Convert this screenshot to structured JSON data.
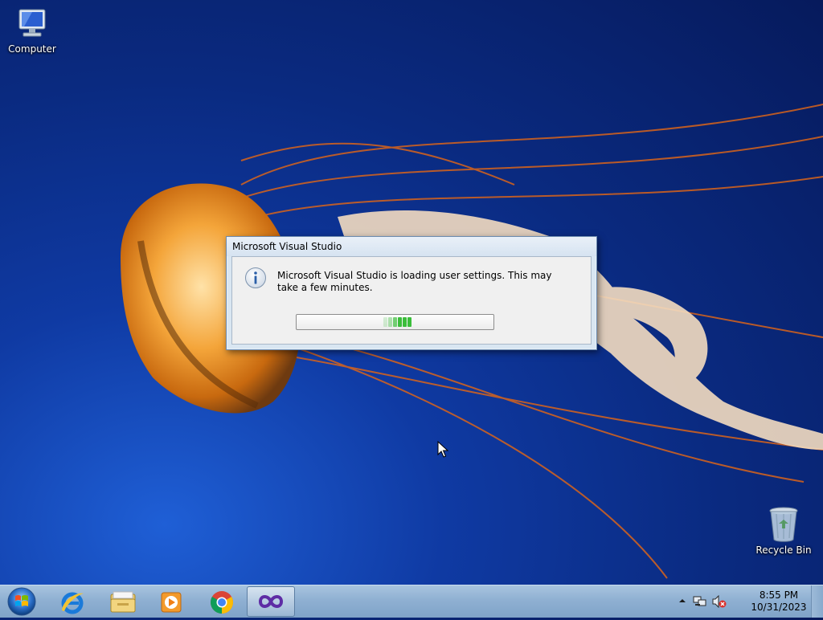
{
  "desktop": {
    "icons": [
      {
        "label": "Computer",
        "icon": "computer-icon"
      },
      {
        "label": "Recycle Bin",
        "icon": "recycle-bin-icon"
      }
    ]
  },
  "dialog": {
    "title": "Microsoft Visual Studio",
    "message": "Microsoft Visual Studio is loading user settings. This may take a few minutes.",
    "icon": "info-icon",
    "progress": {
      "mode": "indeterminate",
      "fill_color": "#3bbd3b"
    }
  },
  "taskbar": {
    "start_icon": "windows-start-orb-icon",
    "pinned": [
      {
        "name": "Internet Explorer",
        "icon": "internet-explorer-icon"
      },
      {
        "name": "Windows Explorer",
        "icon": "file-explorer-icon"
      },
      {
        "name": "Windows Media Player",
        "icon": "media-player-icon"
      },
      {
        "name": "Google Chrome",
        "icon": "chrome-icon"
      },
      {
        "name": "Microsoft Visual Studio",
        "icon": "visual-studio-icon",
        "active": true
      }
    ],
    "tray": {
      "icons": [
        "show-hidden-icons-chevron",
        "network-icon",
        "volume-muted-icon"
      ],
      "time": "8:55 PM",
      "date": "10/31/2023"
    }
  },
  "colors": {
    "desktop_blue": "#0a2a80",
    "taskbar": "#8fb0d2",
    "progress_green": "#3bbd3b"
  }
}
